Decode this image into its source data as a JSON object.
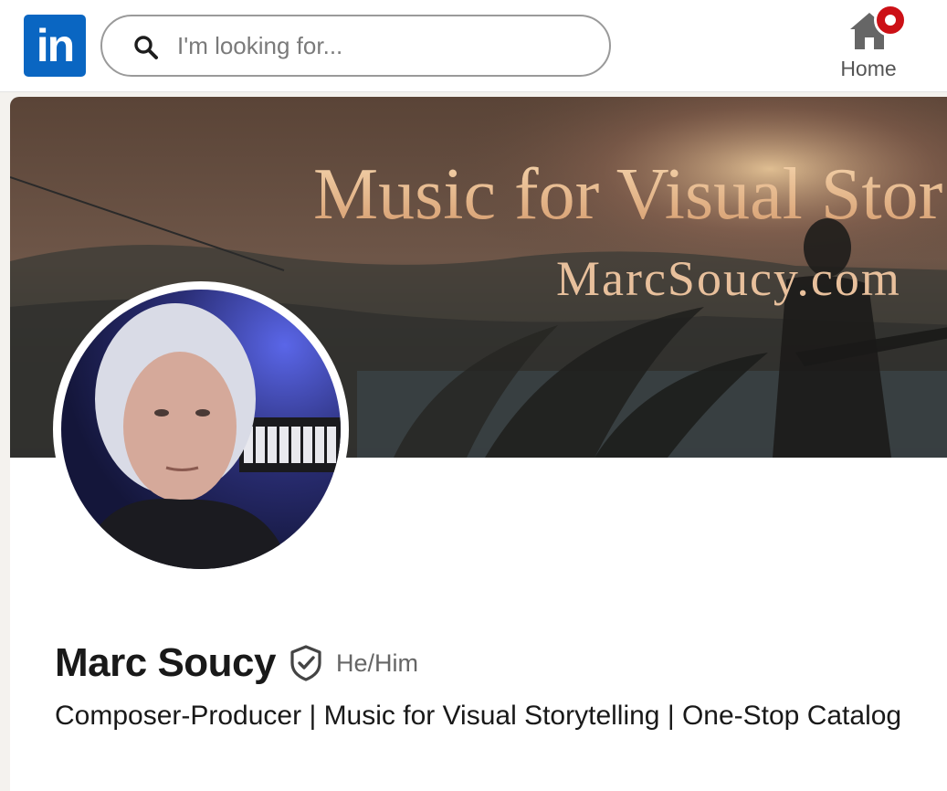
{
  "nav": {
    "logo_text": "in",
    "search_placeholder": "I'm looking for...",
    "home_label": "Home",
    "brand_color": "#0a66c2",
    "notification_color": "#cc1016"
  },
  "banner": {
    "title": "Music for Visual Stor",
    "website": "MarcSoucy.com"
  },
  "profile": {
    "name": "Marc Soucy",
    "pronouns": "He/Him",
    "headline": "Composer-Producer | Music for Visual Storytelling | One-Stop Catalog"
  },
  "icons": [
    "linkedin-logo",
    "search-icon",
    "home-icon",
    "notification-badge",
    "verified-shield-icon"
  ]
}
